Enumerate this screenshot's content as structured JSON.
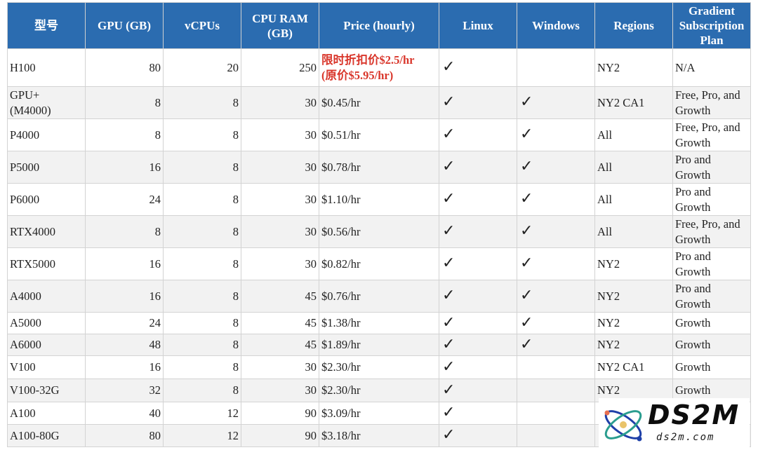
{
  "headers": [
    "型号",
    "GPU (GB)",
    "vCPUs",
    "CPU RAM (GB)",
    "Price (hourly)",
    "Linux",
    "Windows",
    "Regions",
    "Gradient Subscription Plan"
  ],
  "rows": [
    {
      "model": "H100",
      "gpu": "80",
      "vcpus": "20",
      "ram": "250",
      "price": "",
      "promo_line1": "限时折扣价$2.5/hr",
      "promo_line2": "(原价$5.95/hr)",
      "linux": "✓",
      "windows": "",
      "regions": "NY2",
      "plan": "N/A"
    },
    {
      "model": "GPU+ (M4000)",
      "gpu": "8",
      "vcpus": "8",
      "ram": "30",
      "price": "$0.45/hr",
      "linux": "✓",
      "windows": "✓",
      "regions": "NY2 CA1",
      "plan": "Free, Pro, and Growth"
    },
    {
      "model": "P4000",
      "gpu": "8",
      "vcpus": "8",
      "ram": "30",
      "price": "$0.51/hr",
      "linux": "✓",
      "windows": "✓",
      "regions": "All",
      "plan": "Free, Pro, and Growth"
    },
    {
      "model": "P5000",
      "gpu": "16",
      "vcpus": "8",
      "ram": "30",
      "price": "$0.78/hr",
      "linux": "✓",
      "windows": "✓",
      "regions": "All",
      "plan": "Pro and Growth"
    },
    {
      "model": "P6000",
      "gpu": "24",
      "vcpus": "8",
      "ram": "30",
      "price": "$1.10/hr",
      "linux": "✓",
      "windows": "✓",
      "regions": "All",
      "plan": "Pro and Growth"
    },
    {
      "model": "RTX4000",
      "gpu": "8",
      "vcpus": "8",
      "ram": "30",
      "price": "$0.56/hr",
      "linux": "✓",
      "windows": "✓",
      "regions": "All",
      "plan": "Free, Pro, and Growth"
    },
    {
      "model": "RTX5000",
      "gpu": "16",
      "vcpus": "8",
      "ram": "30",
      "price": "$0.82/hr",
      "linux": "✓",
      "windows": "✓",
      "regions": "NY2",
      "plan": "Pro and Growth"
    },
    {
      "model": "A4000",
      "gpu": "16",
      "vcpus": "8",
      "ram": "45",
      "price": "$0.76/hr",
      "linux": "✓",
      "windows": "✓",
      "regions": "NY2",
      "plan": "Pro and Growth"
    },
    {
      "model": "A5000",
      "gpu": "24",
      "vcpus": "8",
      "ram": "45",
      "price": "$1.38/hr",
      "linux": "✓",
      "windows": "✓",
      "regions": "NY2",
      "plan": "Growth"
    },
    {
      "model": "A6000",
      "gpu": "48",
      "vcpus": "8",
      "ram": "45",
      "price": "$1.89/hr",
      "linux": "✓",
      "windows": "✓",
      "regions": "NY2",
      "plan": "Growth"
    },
    {
      "model": "V100",
      "gpu": "16",
      "vcpus": "8",
      "ram": "30",
      "price": "$2.30/hr",
      "linux": "✓",
      "windows": "",
      "regions": "NY2 CA1",
      "plan": "Growth"
    },
    {
      "model": "V100-32G",
      "gpu": "32",
      "vcpus": "8",
      "ram": "30",
      "price": "$2.30/hr",
      "linux": "✓",
      "windows": "",
      "regions": "NY2",
      "plan": "Growth"
    },
    {
      "model": "A100",
      "gpu": "40",
      "vcpus": "12",
      "ram": "90",
      "price": "$3.09/hr",
      "linux": "✓",
      "windows": "",
      "regions": "",
      "plan": ""
    },
    {
      "model": "A100-80G",
      "gpu": "80",
      "vcpus": "12",
      "ram": "90",
      "price": "$3.18/hr",
      "linux": "✓",
      "windows": "",
      "regions": "",
      "plan": ""
    }
  ],
  "watermark": {
    "brand": "DS2M",
    "url": "ds2m.com"
  },
  "colors": {
    "header_bg": "#2B6CB0",
    "promo": "#d9362b",
    "row_alt": "#f2f2f2"
  }
}
